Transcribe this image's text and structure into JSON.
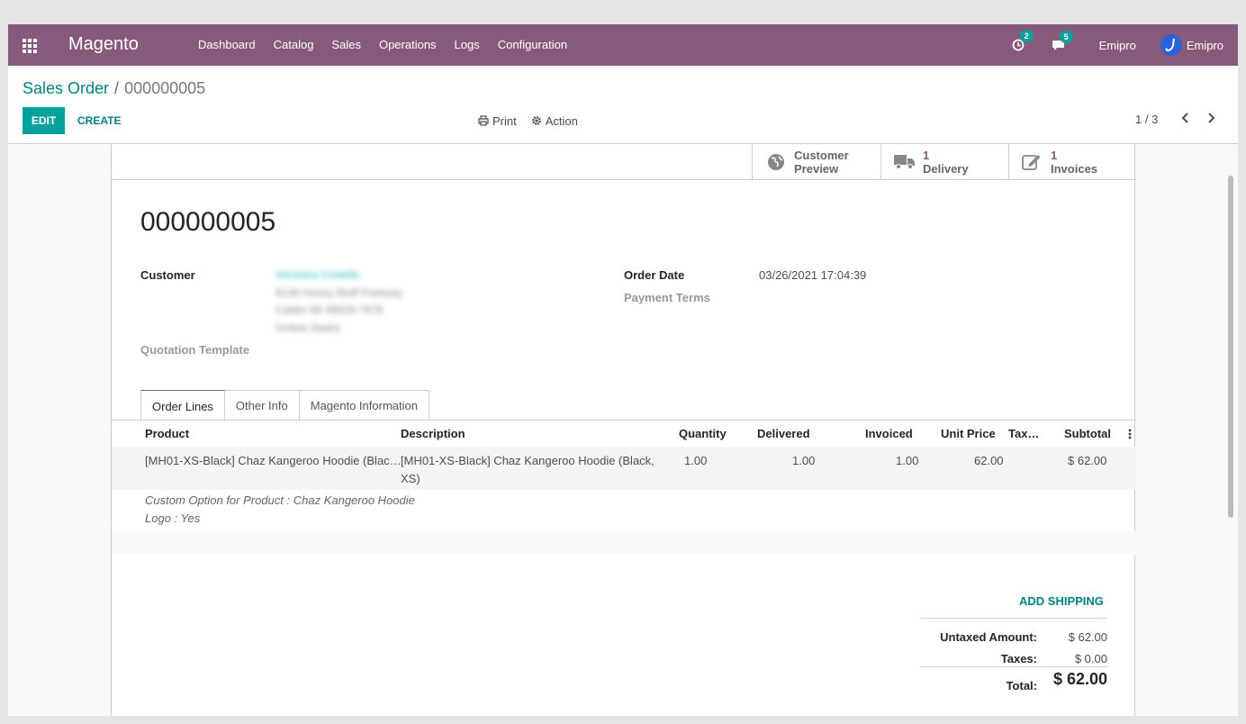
{
  "navbar": {
    "brand": "Magento",
    "menu": [
      "Dashboard",
      "Catalog",
      "Sales",
      "Operations",
      "Logs",
      "Configuration"
    ],
    "activity_count": "2",
    "message_count": "5",
    "company": "Emipro",
    "user": "Emipro",
    "color": "#875a7b"
  },
  "breadcrumb": {
    "parent": "Sales Order",
    "separator": "/",
    "current": "000000005"
  },
  "toolbar": {
    "edit": "EDIT",
    "create": "CREATE",
    "print": "Print",
    "action": "Action"
  },
  "pager": {
    "value": "1 / 3"
  },
  "smart_buttons": {
    "preview": {
      "line1": "Customer",
      "line2": "Preview",
      "icon": "globe-icon"
    },
    "delivery": {
      "count": "1",
      "label": "Delivery",
      "icon": "truck-icon"
    },
    "invoices": {
      "count": "1",
      "label": "Invoices",
      "icon": "pencil-square-icon"
    }
  },
  "order": {
    "name": "000000005",
    "customer_label": "Customer",
    "customer_name": "Veronica Costello",
    "customer_address": [
      "6146 Honey Bluff Parkway",
      "Calder MI 49628-7978",
      "United States"
    ],
    "quotation_template_label": "Quotation Template",
    "order_date_label": "Order Date",
    "order_date": "03/26/2021 17:04:39",
    "payment_terms_label": "Payment Terms"
  },
  "tabs": [
    "Order Lines",
    "Other Info",
    "Magento Information"
  ],
  "lines_table": {
    "headers": [
      "Product",
      "Description",
      "Quantity",
      "Delivered",
      "Invoiced",
      "Unit Price",
      "Tax…",
      "Subtotal"
    ],
    "rows": [
      {
        "product": "[MH01-XS-Black] Chaz Kangeroo Hoodie (Blac…",
        "description_1": "[MH01-XS-Black] Chaz Kangeroo Hoodie (Black,",
        "description_2": "XS)",
        "quantity": "1.00",
        "delivered": "1.00",
        "invoiced": "1.00",
        "unit_price": "62.00",
        "taxes": "",
        "subtotal": "$ 62.00"
      }
    ],
    "notes": [
      "Custom Option for Product : Chaz Kangeroo Hoodie",
      "Logo : Yes"
    ]
  },
  "add_shipping": "ADD SHIPPING",
  "totals": {
    "untaxed_label": "Untaxed Amount:",
    "untaxed": "$ 62.00",
    "taxes_label": "Taxes:",
    "taxes": "$ 0.00",
    "total_label": "Total:",
    "total": "$ 62.00"
  },
  "accent_color": "#00a09d"
}
